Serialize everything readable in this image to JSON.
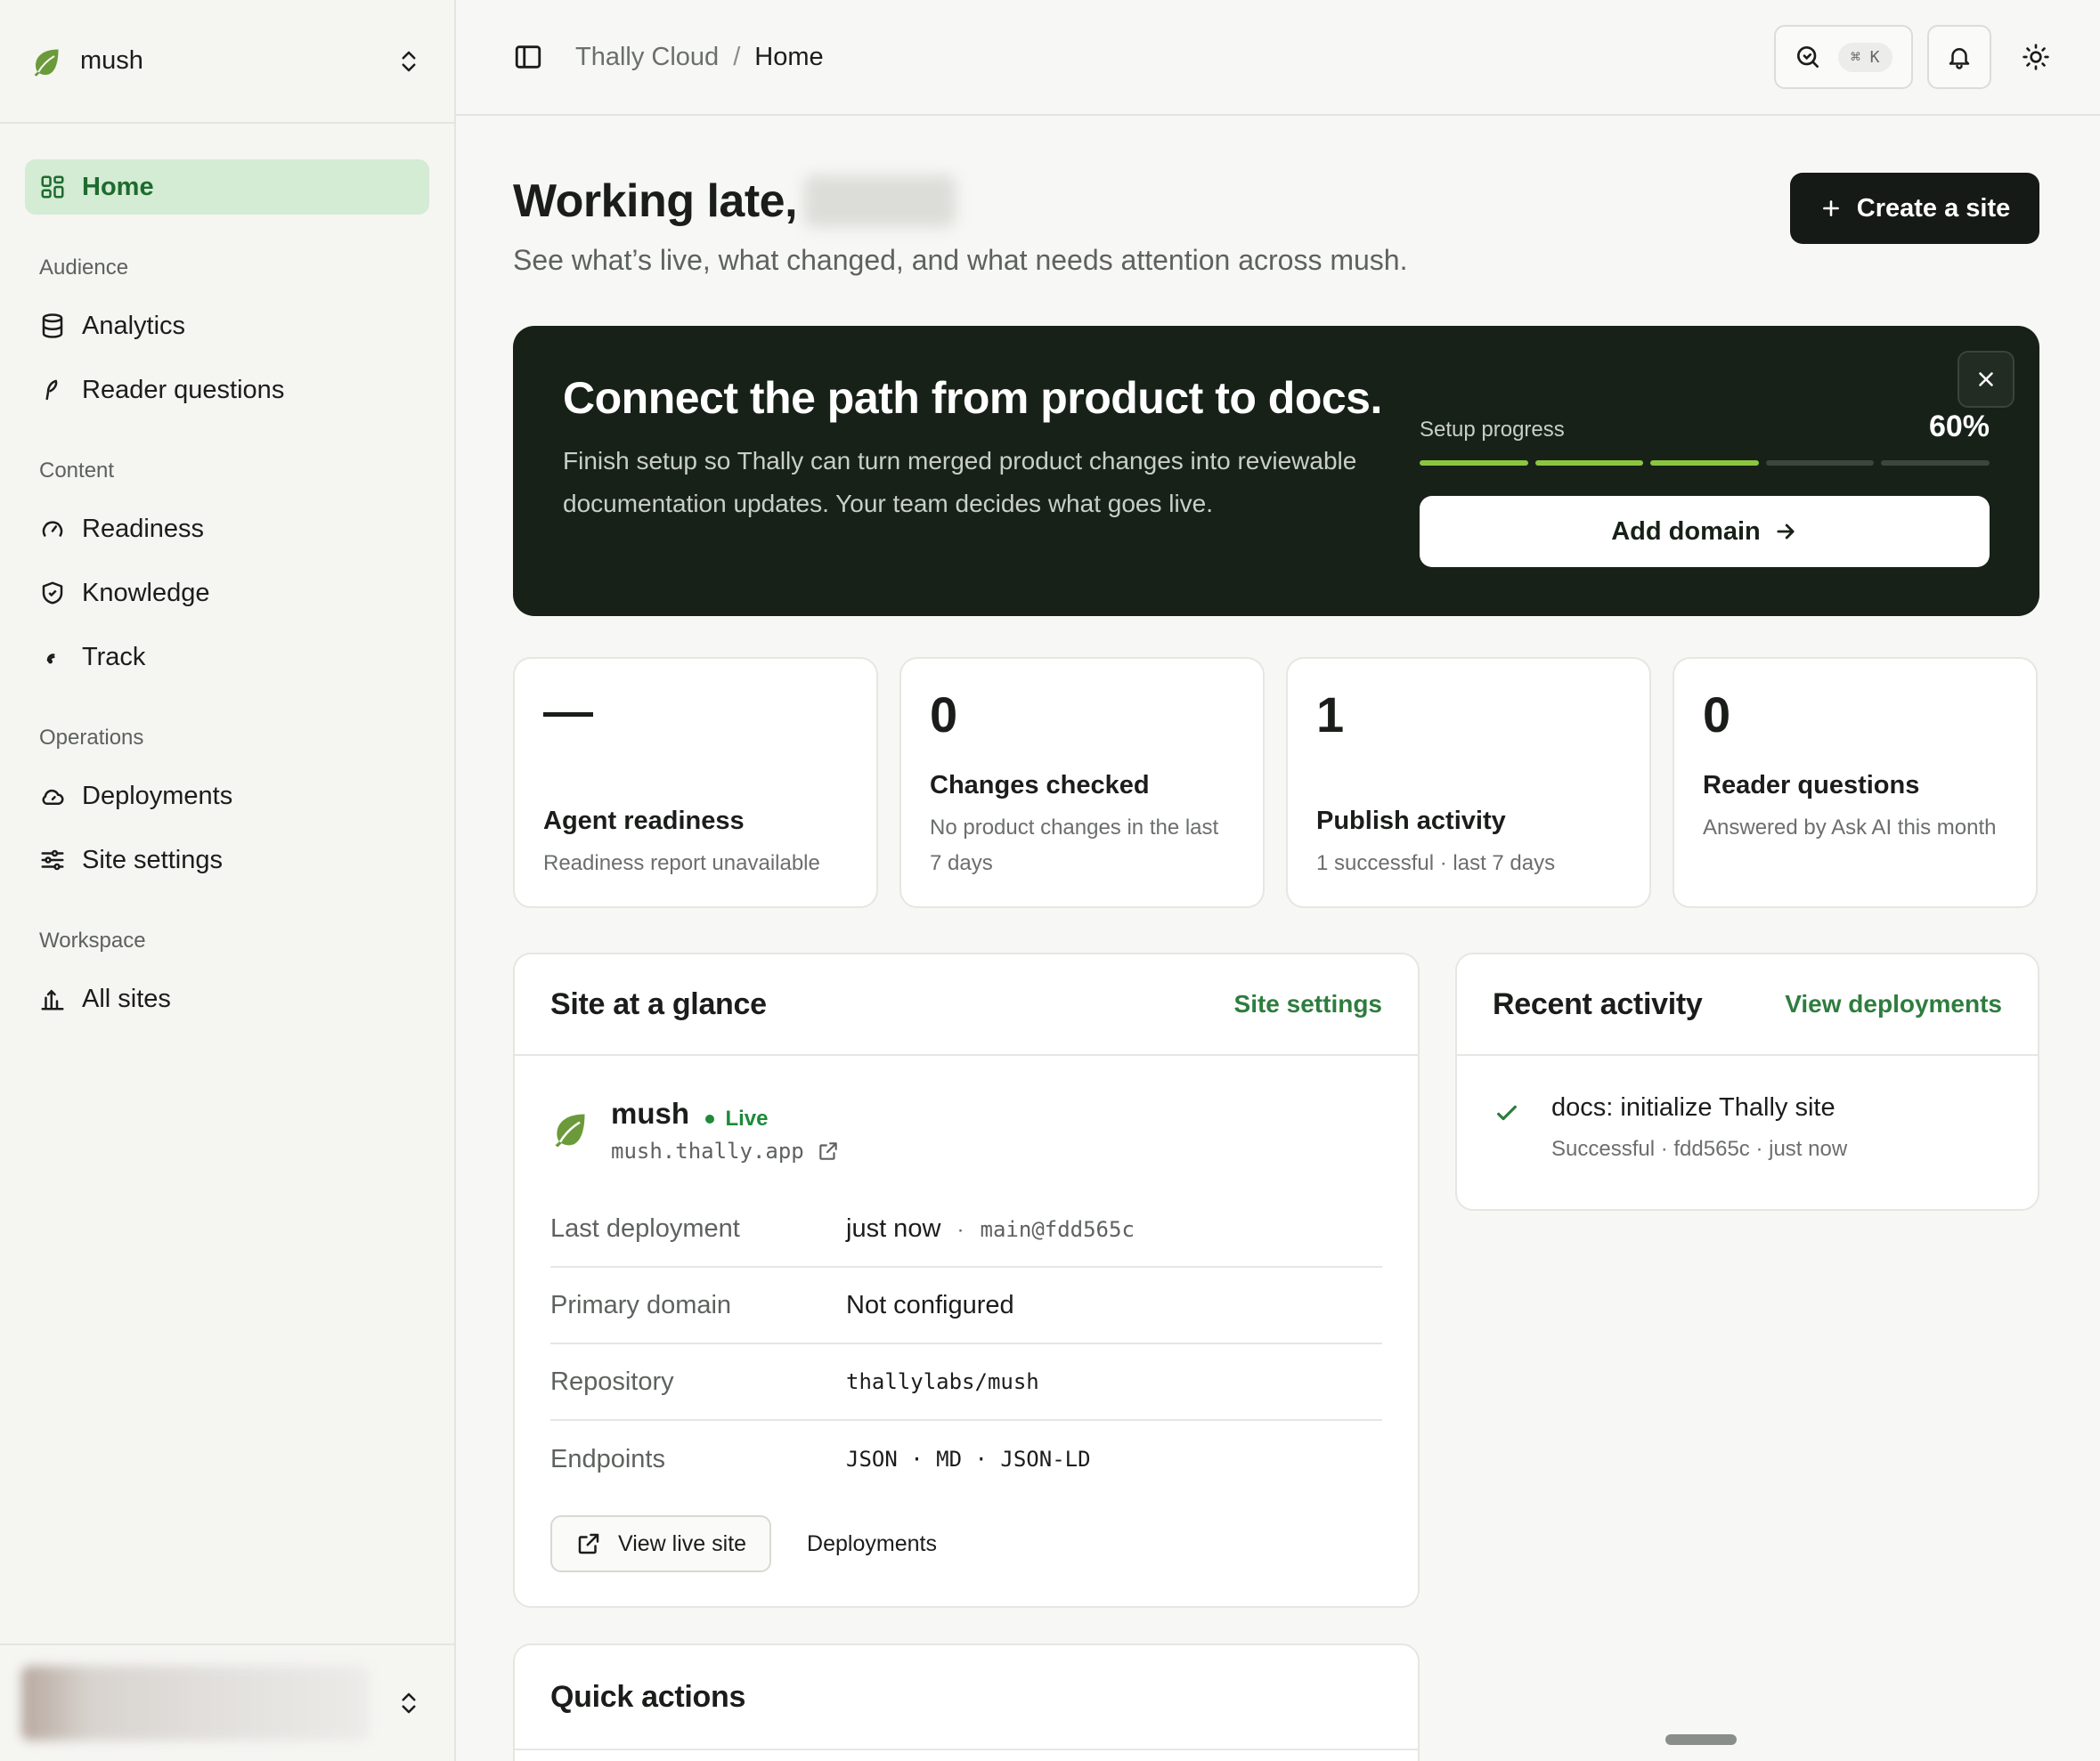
{
  "workspace": {
    "name": "mush"
  },
  "nav": {
    "home": "Home",
    "sections": {
      "audience": "Audience",
      "content": "Content",
      "operations": "Operations",
      "workspace": "Workspace"
    },
    "items": {
      "analytics": "Analytics",
      "reader_questions": "Reader questions",
      "readiness": "Readiness",
      "knowledge": "Knowledge",
      "track": "Track",
      "deployments": "Deployments",
      "site_settings": "Site settings",
      "all_sites": "All sites"
    }
  },
  "breadcrumb": {
    "root": "Thally Cloud",
    "separator": "/",
    "current": "Home"
  },
  "search": {
    "shortcut": "⌘ K"
  },
  "header": {
    "greeting": "Working late,",
    "subtitle": "See what’s live, what changed, and what needs attention across mush.",
    "create_label": "Create a site"
  },
  "banner": {
    "title": "Connect the path from product to docs.",
    "body": "Finish setup so Thally can turn merged product changes into reviewable documentation updates. Your team decides what goes live.",
    "progress_label": "Setup progress",
    "progress_text": "60%",
    "progress_fraction": 0.6,
    "segments_total": 5,
    "segments_done": 3,
    "cta_label": "Add domain"
  },
  "stats": [
    {
      "value": "—",
      "title": "Agent readiness",
      "desc": "Readiness report unavailable"
    },
    {
      "value": "0",
      "title": "Changes checked",
      "desc": "No product changes in the last 7 days"
    },
    {
      "value": "1",
      "title": "Publish activity",
      "desc": "1 successful · last 7 days"
    },
    {
      "value": "0",
      "title": "Reader questions",
      "desc": "Answered by Ask AI this month"
    }
  ],
  "glance": {
    "title": "Site at a glance",
    "link": "Site settings",
    "site_name": "mush",
    "status": "Live",
    "url": "mush.thally.app",
    "rows": {
      "last_deployment": {
        "key": "Last deployment",
        "value": "just now",
        "sep": "·",
        "ref": "main@fdd565c"
      },
      "primary_domain": {
        "key": "Primary domain",
        "value": "Not configured"
      },
      "repository": {
        "key": "Repository",
        "value": "thallylabs/mush"
      },
      "endpoints": {
        "key": "Endpoints",
        "value": "JSON · MD · JSON-LD"
      }
    },
    "view_live": "View live site",
    "deployments": "Deployments"
  },
  "activity": {
    "title": "Recent activity",
    "link": "View deployments",
    "items": [
      {
        "title": "docs: initialize Thally site",
        "sub": "Successful · fdd565c · just now"
      }
    ]
  },
  "quick": {
    "title": "Quick actions"
  },
  "colors": {
    "accent": "#2e7d3e",
    "active_nav_bg": "#d4ebd4",
    "banner_bg": "#172118",
    "progress_on": "#8cc63f",
    "live": "#1e8a3a"
  }
}
